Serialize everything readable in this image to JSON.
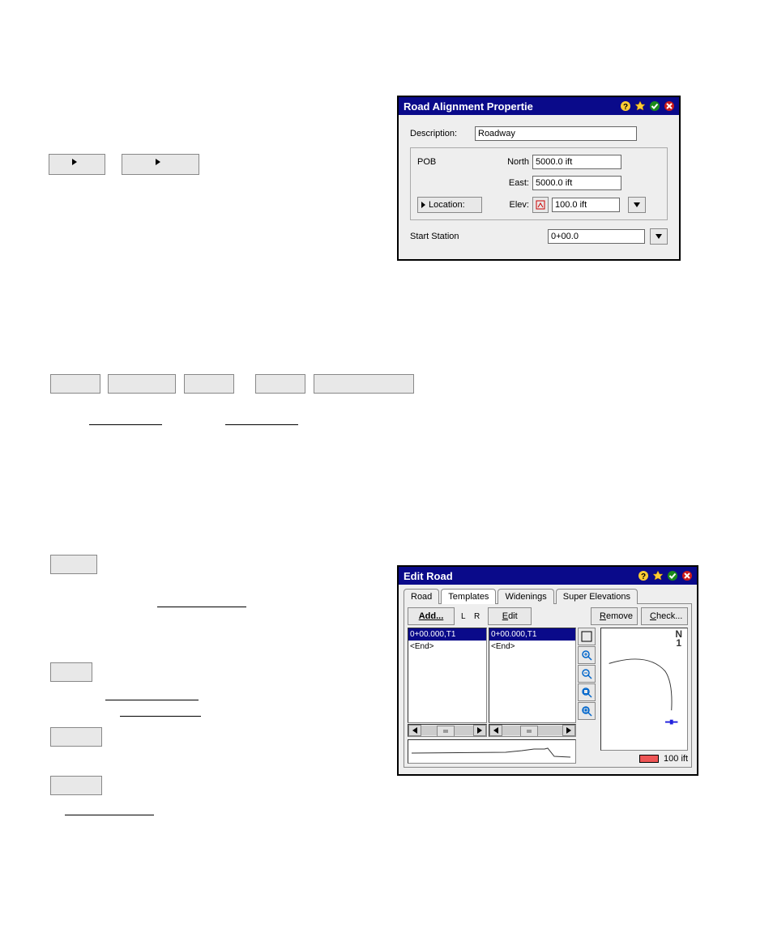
{
  "placeholders": {
    "p1": " ",
    "p2": " "
  },
  "toolbar_btns": {
    "b1": " ",
    "b2": " ",
    "b3": " ",
    "b4": " ",
    "b5": " "
  },
  "link1": " ",
  "link2": " ",
  "mid_btn": " ",
  "mid_text": " ",
  "bottom_btns": {
    "b1": " ",
    "b2": " ",
    "b3": " "
  },
  "bottom_links": {
    "l1": " ",
    "l2": " ",
    "l3": " "
  },
  "dlg_align": {
    "title": "Road Alignment Propertie",
    "desc_label": "Description:",
    "desc_value": "Roadway",
    "pob": "POB",
    "north_label": "North",
    "north_value": "5000.0 ift",
    "east_label": "East:",
    "east_value": "5000.0 ift",
    "elev_label": "Elev:",
    "elev_value": "100.0 ift",
    "location_btn": "Location:",
    "start_station_label": "Start Station",
    "start_station_value": "0+00.0"
  },
  "dlg_road": {
    "title": "Edit Road",
    "tabs": {
      "road": "Road",
      "templates": "Templates",
      "widenings": "Widenings",
      "super": "Super Elevations"
    },
    "buttons": {
      "add": "Add...",
      "edit": "Edit",
      "remove": "Remove",
      "check": "Check..."
    },
    "LR": "L   R",
    "left_list": {
      "sel": "0+00.000,T1",
      "end": "<End>"
    },
    "right_list": {
      "sel": "0+00.000,T1",
      "end": "<End>"
    },
    "scale_label": "100 ift",
    "north_label": "N",
    "north_sub": "1"
  }
}
